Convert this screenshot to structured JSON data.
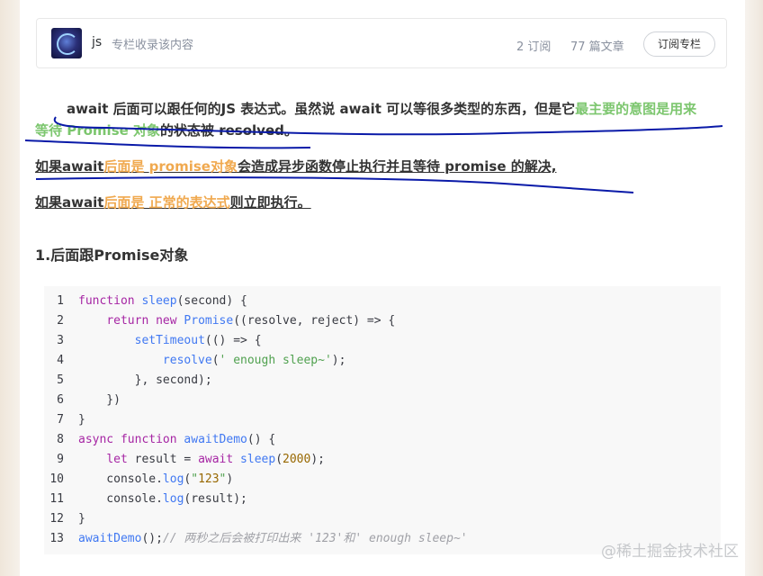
{
  "column": {
    "name": "js",
    "desc": "专栏收录该内容",
    "subs": "2 订阅",
    "articles": "77 篇文章",
    "subscribe_label": "订阅专栏"
  },
  "article": {
    "p1_a": "await 后面可以跟任何的JS 表达式。虽然说 await 可以等很多类型的东西，但是它",
    "p1_green1": "最主要的意图是用来",
    "p1_green2": "等待 Promise 对象",
    "p1_b": "的状态被 resolved。",
    "p2_a": "如果await",
    "p2_orange1": "后面是 ",
    "p2_orange2": "promise对象",
    "p2_b": "会造成异步函数停止执行并且等待 promise 的解决,",
    "p3_a": "如果await",
    "p3_orange": "后面是 正常的表达式",
    "p3_b": "则立即执行。",
    "section_title": "1.后面跟Promise对象"
  },
  "code": {
    "lines": [
      {
        "n": "1",
        "t": "function sleep(second) {"
      },
      {
        "n": "2",
        "t": "    return new Promise((resolve, reject) => {"
      },
      {
        "n": "3",
        "t": "        setTimeout(() => {"
      },
      {
        "n": "4",
        "t": "            resolve(' enough sleep~');"
      },
      {
        "n": "5",
        "t": "        }, second);"
      },
      {
        "n": "6",
        "t": "    })"
      },
      {
        "n": "7",
        "t": "}"
      },
      {
        "n": "8",
        "t": "async function awaitDemo() {"
      },
      {
        "n": "9",
        "t": "    let result = await sleep(2000);"
      },
      {
        "n": "10",
        "t": "    console.log(\"123\")"
      },
      {
        "n": "11",
        "t": "    console.log(result);"
      },
      {
        "n": "12",
        "t": "}"
      },
      {
        "n": "13",
        "t": "awaitDemo();// 两秒之后会被打印出来 '123'和' enough sleep~'"
      }
    ]
  },
  "watermark": "@稀土掘金技术社区",
  "colors": {
    "green": "#7cc66e",
    "orange": "#f0a94f",
    "ink": "#0a1aa8"
  }
}
